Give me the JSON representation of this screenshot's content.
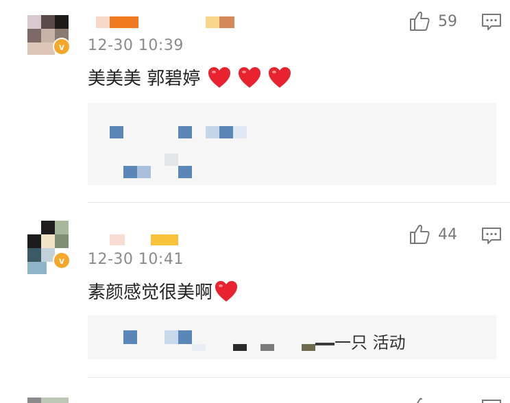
{
  "comments": [
    {
      "time": "12-30 10:39",
      "text": "美美美 郭碧婷",
      "hearts": 3,
      "likes": "59",
      "icons": {
        "like": "thumbs-up-icon",
        "reply": "comment-bubble-icon",
        "badge": "verified-v-icon"
      }
    },
    {
      "time": "12-30 10:41",
      "text": "素颜感觉很美啊",
      "hearts": 1,
      "likes": "44",
      "reply_tail": "一只 活动",
      "icons": {
        "like": "thumbs-up-icon",
        "reply": "comment-bubble-icon",
        "badge": "verified-v-icon"
      }
    }
  ],
  "badge_letter": "v",
  "colors": {
    "heart": "#e8232f",
    "badge": "#f4a72a",
    "time": "#8a8a8a",
    "mosaic_blue": "#5b86b8"
  }
}
